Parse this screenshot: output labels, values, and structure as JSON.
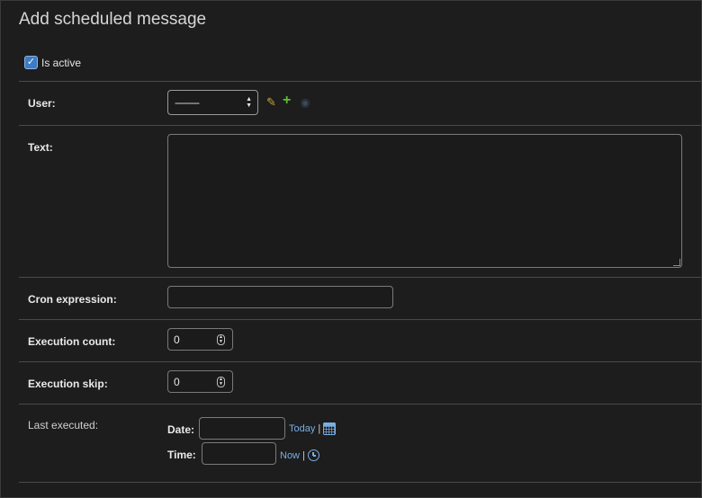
{
  "page": {
    "title": "Add scheduled message"
  },
  "form": {
    "is_active": {
      "label": "Is active",
      "checked": true,
      "check_glyph": "✓"
    },
    "user": {
      "label": "User:",
      "selected_value": "---------",
      "icons": [
        "pencil-icon",
        "plus-icon",
        "eye-icon"
      ]
    },
    "text": {
      "label": "Text:",
      "value": ""
    },
    "cron_expression": {
      "label": "Cron expression:",
      "value": ""
    },
    "execution_count": {
      "label": "Execution count:",
      "value": "0"
    },
    "execution_skip": {
      "label": "Execution skip:",
      "value": "0"
    },
    "last_executed": {
      "label": "Last executed:",
      "date_label": "Date:",
      "date_value": "",
      "today_link": "Today",
      "time_label": "Time:",
      "time_value": "",
      "now_link": "Now",
      "separator": "|"
    }
  },
  "colors": {
    "background": "#1d1d1d",
    "link": "#79aee3",
    "checkbox": "#3d7bc5",
    "add_icon": "#5fbf3a",
    "edit_icon": "#c9a63e"
  }
}
